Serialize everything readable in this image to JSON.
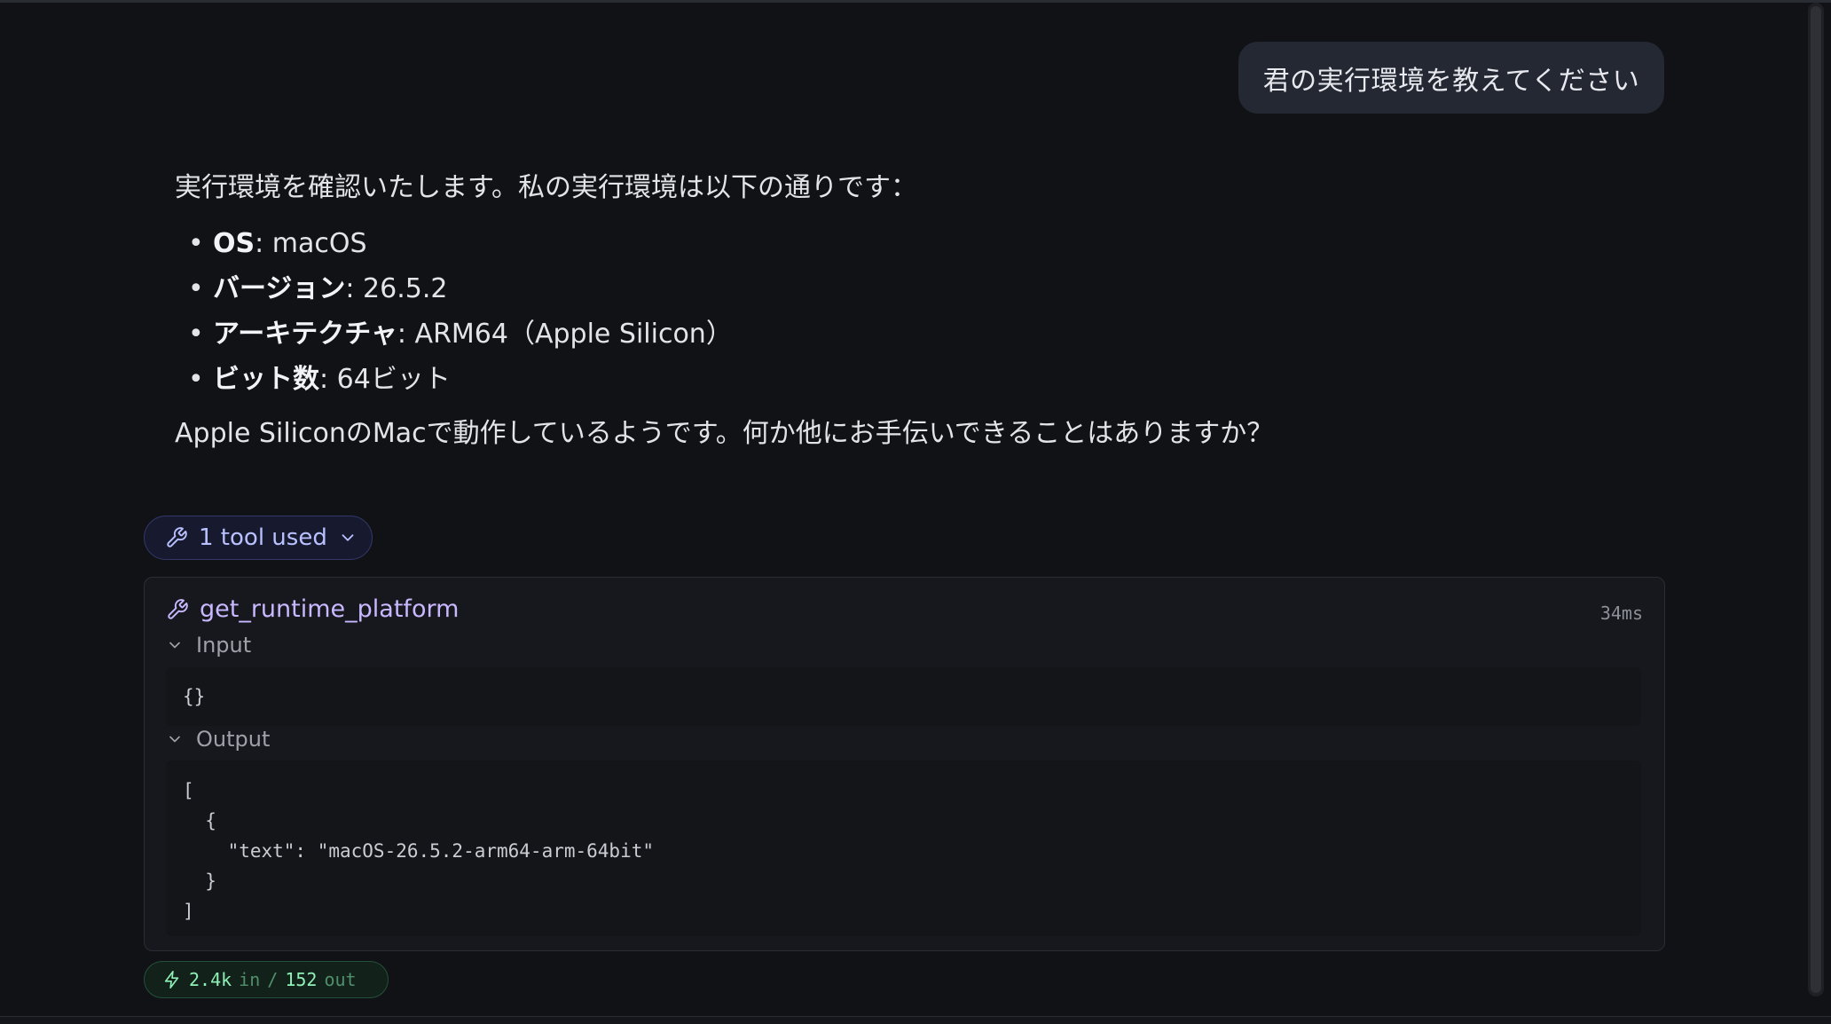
{
  "user_message": "君の実行環境を教えてください",
  "assistant": {
    "intro": "実行環境を確認いたします。私の実行環境は以下の通りです：",
    "items": [
      {
        "label": "OS",
        "value": ": macOS"
      },
      {
        "label": "バージョン",
        "value": ": 26.5.2"
      },
      {
        "label": "アーキテクチャ",
        "value": ": ARM64（Apple Silicon）"
      },
      {
        "label": "ビット数",
        "value": ": 64ビット"
      }
    ],
    "outro": "Apple SiliconのMacで動作しているようです。何か他にお手伝いできることはありますか？"
  },
  "tool_chip": {
    "label": "1 tool used",
    "icon": "wrench-icon",
    "chevron": "chevron-down-icon"
  },
  "tool_call": {
    "name": "get_runtime_platform",
    "duration": "34ms",
    "input_label": "Input",
    "input_code": "{}",
    "output_label": "Output",
    "output_code": "[\n  {\n    \"text\": \"macOS-26.5.2-arm64-arm-64bit\"\n  }\n]"
  },
  "usage": {
    "in_value": "2.4k",
    "in_label": "in",
    "separator": "/",
    "out_value": "152",
    "out_label": "out",
    "icon": "bolt-icon"
  },
  "colors": {
    "background": "#111216",
    "tool_accent": "#c9b8ff",
    "chip_text": "#b8c0ff",
    "usage_green": "#8ff0b6"
  }
}
